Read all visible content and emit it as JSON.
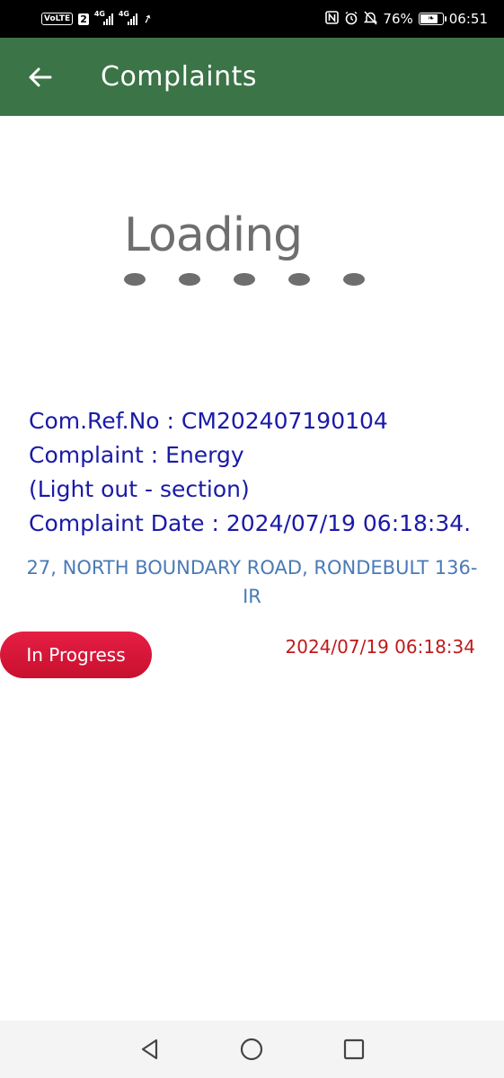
{
  "status_bar": {
    "volte": "VoLTE",
    "sim": "2",
    "network1": "4G",
    "network2": "4G",
    "battery_percent": "76%",
    "battery_level": 0.76,
    "time": "06:51",
    "icons": [
      "nfc-icon",
      "alarm-icon",
      "mute-icon",
      "battery-icon"
    ]
  },
  "app_bar": {
    "title": "Complaints",
    "back_icon": "arrow-left-icon"
  },
  "loading": {
    "word": "Loading"
  },
  "complaint": {
    "ref_line": "Com.Ref.No : CM202407190104",
    "type_line": "Complaint : Energy",
    "subtype_line": "(Light out - section)",
    "date_line": "Complaint Date : 2024/07/19 06:18:34.",
    "address": "27, NORTH BOUNDARY ROAD, RONDEBULT 136-IR",
    "status": "In Progress",
    "status_date": "2024/07/19 06:18:34"
  },
  "nav": {
    "back_icon": "triangle-back-icon",
    "home_icon": "circle-home-icon",
    "recents_icon": "square-recents-icon"
  },
  "colors": {
    "app_bar": "#3b7446",
    "detail_text": "#1a1aa8",
    "address_text": "#4a7ab6",
    "status_pill": "#d8163a",
    "status_date": "#c01a1a"
  }
}
